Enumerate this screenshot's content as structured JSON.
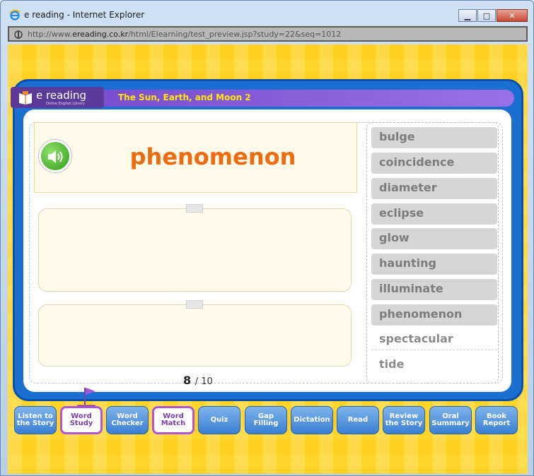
{
  "window": {
    "title": "e reading - Internet Explorer",
    "url_prefix": "http://www.",
    "url_domain": "ereading.co.kr",
    "url_path": "/html/Elearning/test_preview.jsp?study=22&seq=1012"
  },
  "app": {
    "logo_text": "e reading",
    "logo_sub": "Online English Library",
    "lesson_title": "The Sun, Earth, and Moon 2"
  },
  "card": {
    "word": "phenomenon",
    "current": "8",
    "total": "/ 10"
  },
  "word_list": [
    "bulge",
    "coincidence",
    "diameter",
    "eclipse",
    "glow",
    "haunting",
    "illuminate",
    "phenomenon",
    "spectacular",
    "tide"
  ],
  "nav": [
    {
      "line1": "Listen to",
      "line2": "the Story"
    },
    {
      "line1": "Word",
      "line2": "Study"
    },
    {
      "line1": "Word",
      "line2": "Checker"
    },
    {
      "line1": "Word",
      "line2": "Match"
    },
    {
      "line1": "Quiz",
      "line2": ""
    },
    {
      "line1": "Gap",
      "line2": "Filling"
    },
    {
      "line1": "Dictation",
      "line2": ""
    },
    {
      "line1": "Read",
      "line2": ""
    },
    {
      "line1": "Review",
      "line2": "the Story"
    },
    {
      "line1": "Oral",
      "line2": "Summary"
    },
    {
      "line1": "Book",
      "line2": "Report"
    }
  ],
  "colors": {
    "word_orange": "#f06a10",
    "board_blue": "#1a6fd0",
    "header_purple": "#7a4fd0",
    "title_yellow": "#ffe800"
  }
}
